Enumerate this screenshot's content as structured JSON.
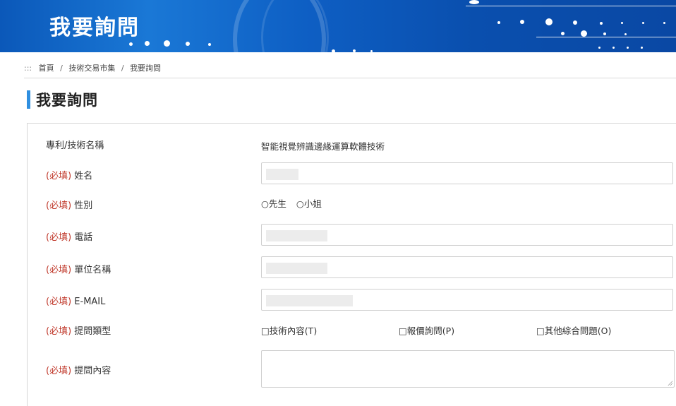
{
  "banner": {
    "title": "我要詢問"
  },
  "breadcrumb": {
    "grip": ":::",
    "home": "首頁",
    "sep": "/",
    "market": "技術交易市集",
    "current": "我要詢問"
  },
  "page_title": "我要詢問",
  "form": {
    "req_tag": "(必填)",
    "tech_name": {
      "label": "專利/技術名稱",
      "value": "智能視覺辨識邊緣運算軟體技術"
    },
    "name": {
      "label": "姓名"
    },
    "gender": {
      "label": "性別",
      "options": [
        "○先生",
        "○小姐"
      ]
    },
    "phone": {
      "label": "電話"
    },
    "unit": {
      "label": "單位名稱"
    },
    "email": {
      "label": "E-MAIL"
    },
    "type": {
      "label": "提問類型",
      "options": [
        "□技術內容(T)",
        "□報價詢問(P)",
        "□其他綜合問題(O)"
      ]
    },
    "content": {
      "label": "提問內容"
    }
  }
}
